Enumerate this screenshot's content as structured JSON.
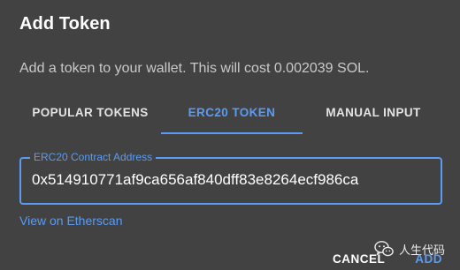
{
  "dialog": {
    "title": "Add Token",
    "subtitle": "Add a token to your wallet. This will cost 0.002039 SOL."
  },
  "tabs": [
    {
      "label": "POPULAR TOKENS",
      "active": false
    },
    {
      "label": "ERC20 TOKEN",
      "active": true
    },
    {
      "label": "MANUAL INPUT",
      "active": false
    }
  ],
  "contract_field": {
    "label": "ERC20 Contract Address",
    "value": "0x514910771af9ca656af840dff83e8264ecf986ca"
  },
  "link": {
    "label": "View on Etherscan"
  },
  "actions": {
    "cancel_label": "CANCEL",
    "add_label": "ADD"
  },
  "watermark": {
    "text": "人生代码",
    "icon": "wechat-icon"
  },
  "colors": {
    "background": "#424242",
    "accent": "#5b9bf2",
    "text": "#ffffff",
    "muted_text": "#c9c9c9"
  }
}
